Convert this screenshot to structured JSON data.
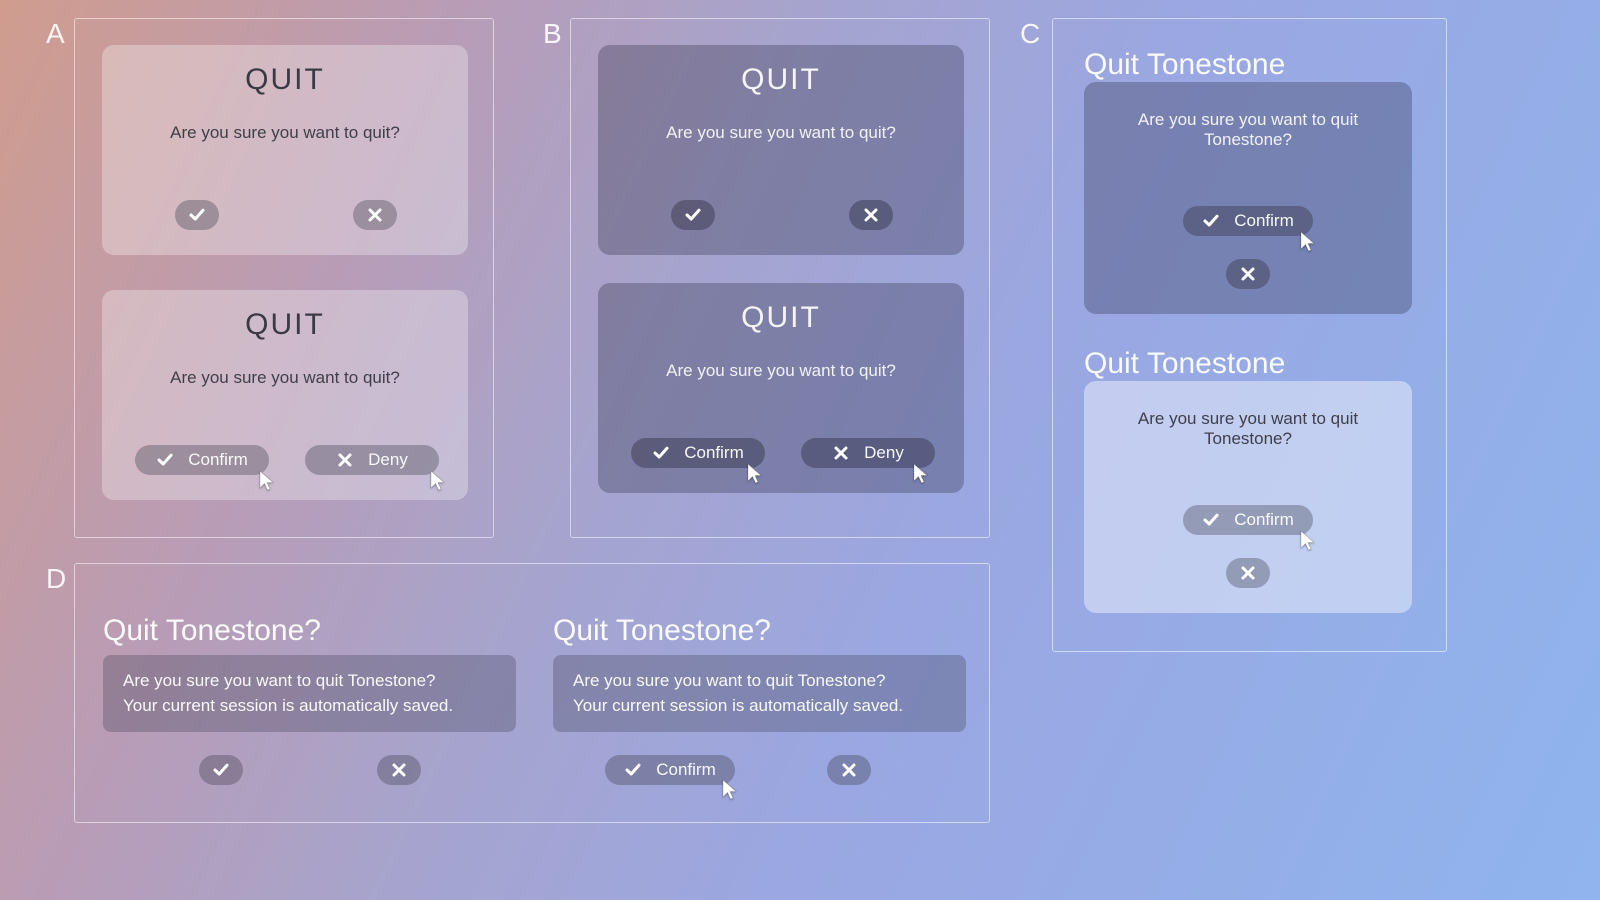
{
  "labels": {
    "A": "A",
    "B": "B",
    "C": "C",
    "D": "D"
  },
  "A": {
    "p1": {
      "title": "QUIT",
      "msg": "Are you sure you want to quit?"
    },
    "p2": {
      "title": "QUIT",
      "msg": "Are you sure you want to quit?",
      "confirm": "Confirm",
      "deny": "Deny"
    }
  },
  "B": {
    "p1": {
      "title": "QUIT",
      "msg": "Are you sure you want to quit?"
    },
    "p2": {
      "title": "QUIT",
      "msg": "Are you sure you want to quit?",
      "confirm": "Confirm",
      "deny": "Deny"
    }
  },
  "C": {
    "title1": "Quit Tonestone",
    "p1": {
      "msg": "Are you sure you want to quit Tonestone?",
      "confirm": "Confirm"
    },
    "title2": "Quit Tonestone",
    "p2": {
      "msg": "Are you sure you want to quit Tonestone?",
      "confirm": "Confirm"
    }
  },
  "D": {
    "title1": "Quit Tonestone?",
    "title2": "Quit Tonestone?",
    "line1": "Are you sure you want to quit Tonestone?",
    "line2": "Your current session is automatically saved.",
    "confirm": "Confirm"
  }
}
